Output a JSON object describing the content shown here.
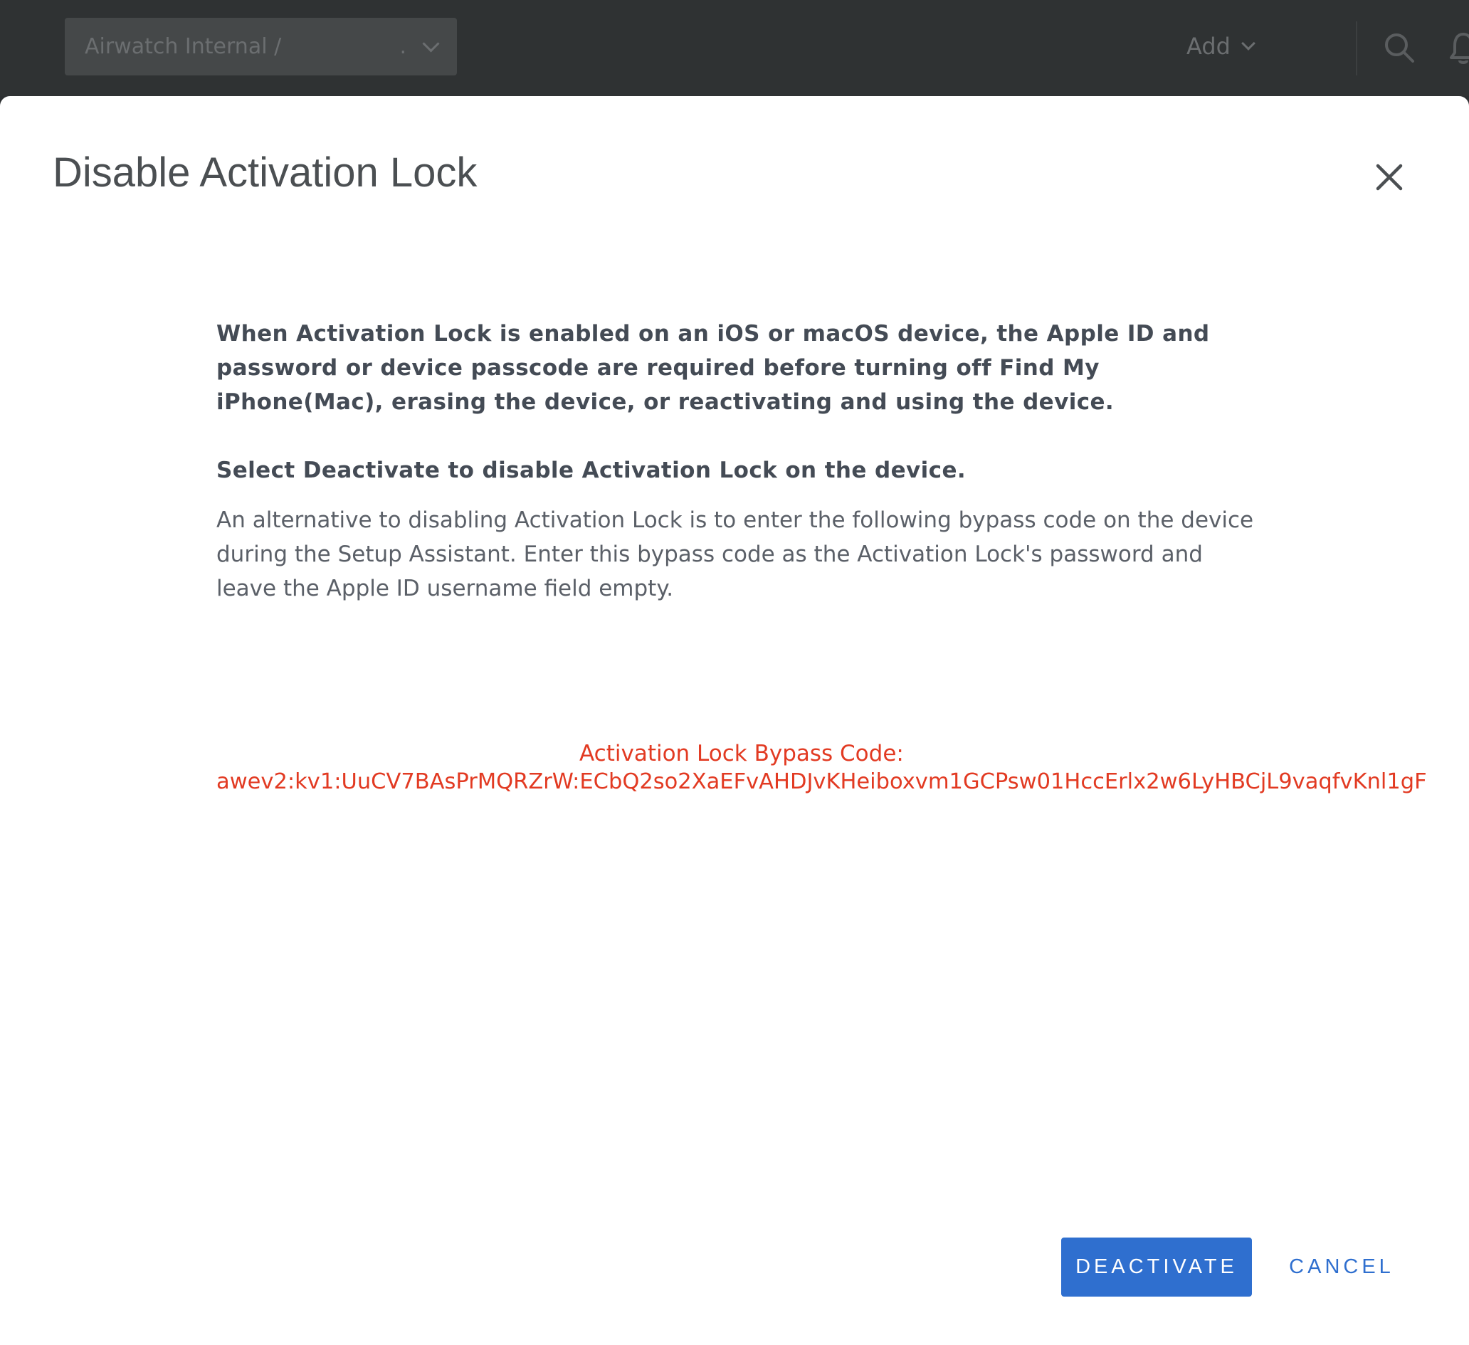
{
  "header": {
    "org_label": "Airwatch Internal /",
    "org_suffix": ".",
    "add_label": "Add"
  },
  "modal": {
    "title": "Disable Activation Lock",
    "intro": "When Activation Lock is enabled on an iOS or macOS device, the Apple ID and password or device passcode are required before turning off Find My iPhone(Mac), erasing the device, or reactivating and using the device.",
    "instruction": "Select Deactivate to disable Activation Lock on the device.",
    "alternative": "An alternative to disabling Activation Lock is to enter the following bypass code on the device during the Setup Assistant. Enter this bypass code as the Activation Lock's password and leave the Apple ID username field empty.",
    "bypass_label": "Activation Lock Bypass Code:",
    "bypass_code": "awev2:kv1:UuCV7BAsPrMQRZrW:ECbQ2so2XaEFvAHDJvKHeiboxvm1GCPsw01HccErlx2w6LyHBCjL9vaqfvKnl1gF",
    "deactivate_label": "DEACTIVATE",
    "cancel_label": "CANCEL"
  },
  "icons": {
    "close": "close-icon",
    "search": "search-icon",
    "bell": "bell-icon",
    "chevron": "chevron-down-icon"
  },
  "colors": {
    "accent": "#2f6fcf",
    "bypass_text": "#e23a22",
    "header_bg": "#2f3233"
  }
}
